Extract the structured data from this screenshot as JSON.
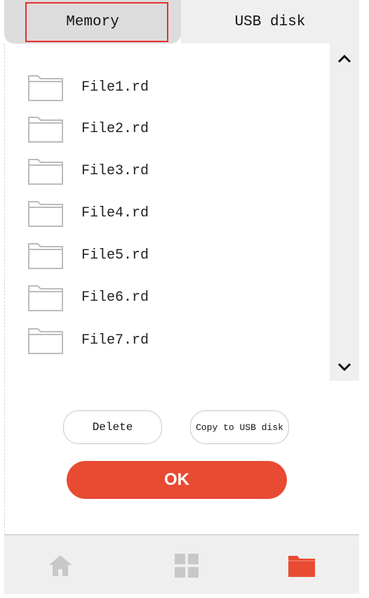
{
  "tabs": {
    "memory_label": "Memory",
    "usb_label": "USB disk",
    "active": "Memory"
  },
  "files": [
    {
      "name": "File1.rd"
    },
    {
      "name": "File2.rd"
    },
    {
      "name": "File3.rd"
    },
    {
      "name": "File4.rd"
    },
    {
      "name": "File5.rd"
    },
    {
      "name": "File6.rd"
    },
    {
      "name": "File7.rd"
    }
  ],
  "actions": {
    "delete_label": "Delete",
    "copy_label": "Copy to USB disk",
    "ok_label": "OK"
  },
  "nav": {
    "items": [
      {
        "icon": "home-icon"
      },
      {
        "icon": "grid-icon"
      },
      {
        "icon": "folder-icon",
        "active": true
      }
    ]
  },
  "colors": {
    "accent": "#e84a32",
    "tab_active_bg": "#dcdcdc",
    "highlight_outline": "#e8302c",
    "nav_bg": "#efefef",
    "icon_inactive": "#c8c8c8"
  }
}
